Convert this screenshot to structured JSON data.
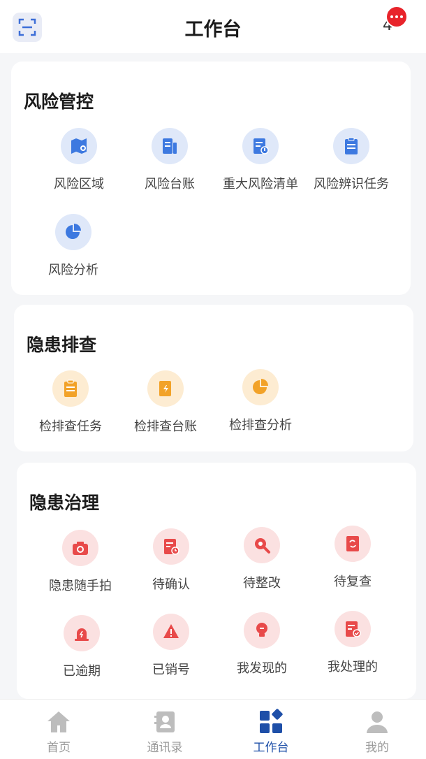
{
  "header": {
    "title": "工作台",
    "message_count": "4"
  },
  "sections": [
    {
      "title": "风险管控",
      "color": "#3d79e0",
      "items": [
        {
          "label": "风险区域",
          "icon": "map-icon"
        },
        {
          "label": "风险台账",
          "icon": "ledger-icon"
        },
        {
          "label": "重大风险清单",
          "icon": "list-alert-icon"
        },
        {
          "label": "风险辨识任务",
          "icon": "clipboard-icon"
        },
        {
          "label": "风险分析",
          "icon": "pie-chart-icon"
        }
      ]
    },
    {
      "title": "隐患排查",
      "color": "#f2a228",
      "items": [
        {
          "label": "检排查任务",
          "icon": "clipboard-icon"
        },
        {
          "label": "检排查台账",
          "icon": "ledger-icon"
        },
        {
          "label": "检排查分析",
          "icon": "pie-chart-icon"
        }
      ]
    },
    {
      "title": "隐患治理",
      "color": "#e84a4a",
      "items": [
        {
          "label": "隐患随手拍",
          "icon": "camera-icon"
        },
        {
          "label": "待确认",
          "icon": "document-clock-icon"
        },
        {
          "label": "待整改",
          "icon": "wrench-gear-icon"
        },
        {
          "label": "待复查",
          "icon": "review-icon"
        },
        {
          "label": "已逾期",
          "icon": "alarm-icon"
        },
        {
          "label": "已销号",
          "icon": "warning-icon"
        },
        {
          "label": "我发现的",
          "icon": "bulb-icon"
        },
        {
          "label": "我处理的",
          "icon": "document-check-icon"
        }
      ]
    }
  ],
  "tabbar": {
    "items": [
      {
        "label": "首页",
        "icon": "home-icon"
      },
      {
        "label": "通讯录",
        "icon": "contacts-icon"
      },
      {
        "label": "工作台",
        "icon": "workbench-icon",
        "active": true
      },
      {
        "label": "我的",
        "icon": "user-icon"
      }
    ]
  }
}
